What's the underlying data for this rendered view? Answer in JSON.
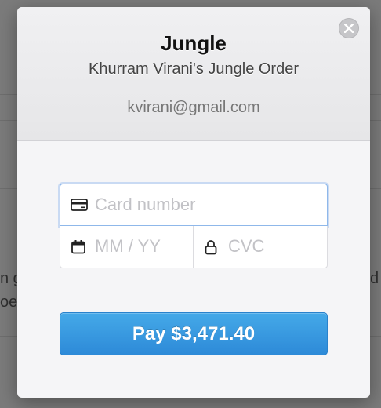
{
  "background": {
    "left_text": "n g",
    "left_text_2": "oe",
    "right_text": "d b"
  },
  "checkout": {
    "merchant": "Jungle",
    "description": "Khurram Virani's Jungle Order",
    "email": "kvirani@gmail.com",
    "card_number_placeholder": "Card number",
    "expiry_placeholder": "MM / YY",
    "cvc_placeholder": "CVC",
    "pay_label": "Pay $3,471.40",
    "colors": {
      "accent": "#3399e0",
      "focus_border": "#8fb8ea"
    },
    "icons": {
      "close": "close-icon",
      "card": "credit-card-icon",
      "calendar": "calendar-icon",
      "lock": "lock-icon"
    }
  }
}
